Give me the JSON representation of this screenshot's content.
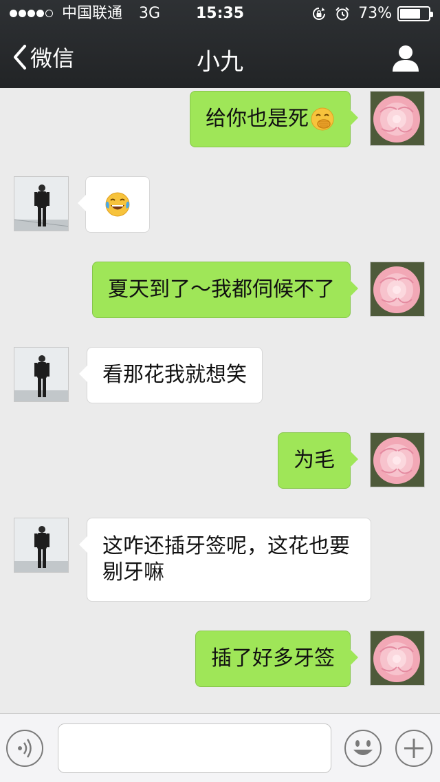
{
  "status_bar": {
    "carrier": "中国联通",
    "network": "3G",
    "time": "15:35",
    "battery_text": "73%",
    "battery_level": 0.73,
    "signal_bars": 4,
    "signal_max": 5
  },
  "nav": {
    "back_label": "微信",
    "title": "小九",
    "contact_icon": "person-icon"
  },
  "messages": [
    {
      "side": "me",
      "text": "给你也是死",
      "emoji": "hand-over-mouth-emoji"
    },
    {
      "side": "them",
      "text": "",
      "emoji": "tears-of-joy-emoji"
    },
    {
      "side": "me",
      "text": "夏天到了～我都伺候不了"
    },
    {
      "side": "them",
      "text": "看那花我就想笑"
    },
    {
      "side": "me",
      "text": "为毛"
    },
    {
      "side": "them",
      "text": "这咋还插牙签呢，这花也要剔牙嘛"
    },
    {
      "side": "me",
      "text": "插了好多牙签"
    }
  ],
  "input_bar": {
    "voice_icon": "voice-icon",
    "input_value": "",
    "emoji_icon": "smiley-icon",
    "plus_icon": "plus-icon"
  },
  "colors": {
    "nav_bg": "#2a2c2e",
    "chat_bg": "#ebebeb",
    "my_bubble": "#9fe658",
    "their_bubble": "#ffffff"
  }
}
